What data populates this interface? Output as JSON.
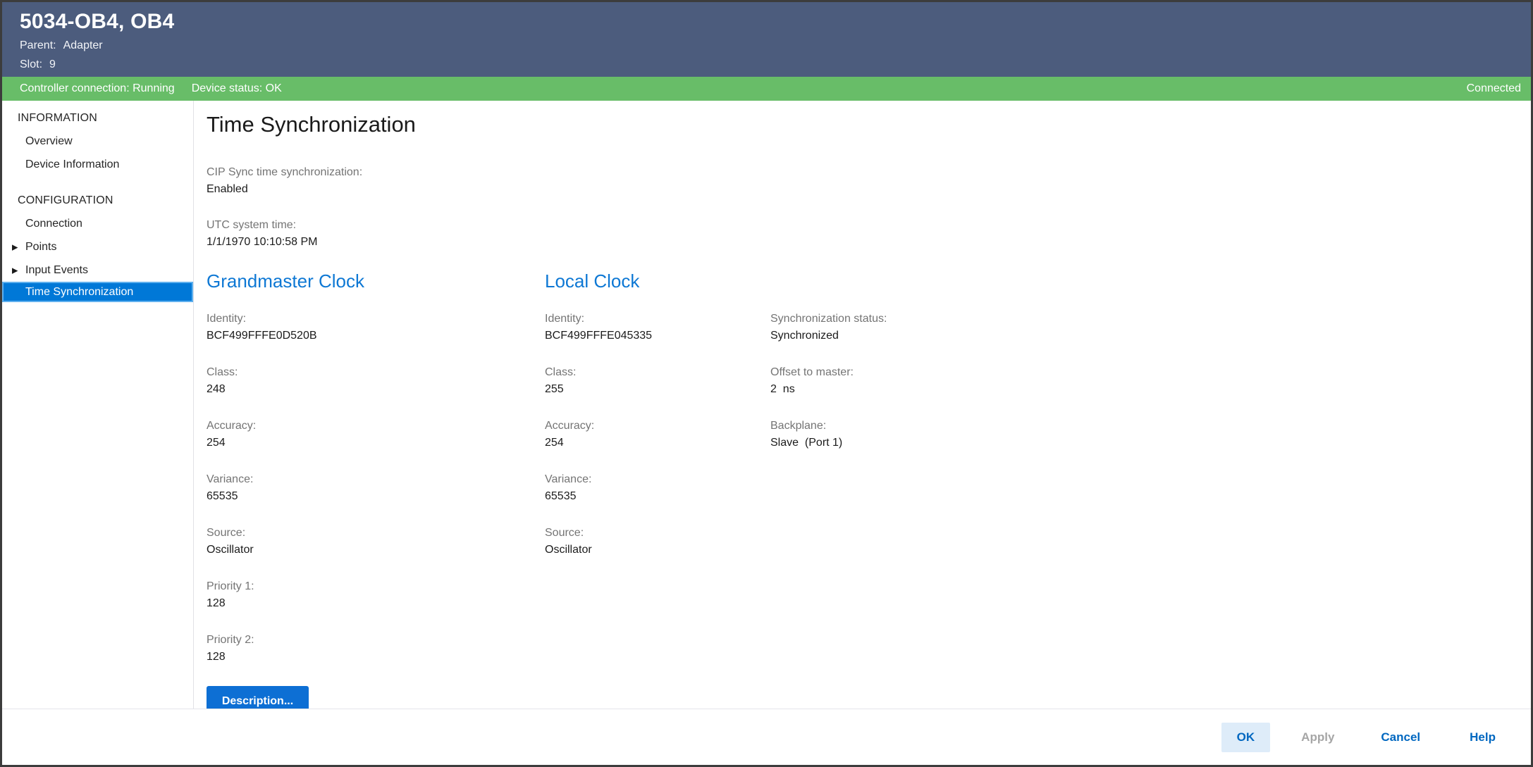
{
  "window": {
    "title": "5034-OB4, OB4",
    "parent_label": "Parent:",
    "parent_value": "Adapter",
    "slot_label": "Slot:",
    "slot_value": "9"
  },
  "status_bar": {
    "controller_connection": "Controller connection: Running",
    "device_status": "Device status: OK",
    "connection_state": "Connected"
  },
  "sidebar": {
    "expand_icon": "▶",
    "sections": [
      {
        "header": "INFORMATION",
        "items": [
          {
            "label": "Overview"
          },
          {
            "label": "Device Information"
          }
        ]
      },
      {
        "header": "CONFIGURATION",
        "items": [
          {
            "label": "Connection"
          },
          {
            "label": "Points",
            "expandable": true
          },
          {
            "label": "Input Events",
            "expandable": true
          },
          {
            "label": "Time Synchronization",
            "selected": true
          }
        ]
      }
    ]
  },
  "main": {
    "title": "Time Synchronization",
    "top_fields": [
      {
        "label": "CIP Sync time synchronization:",
        "value": "Enabled"
      },
      {
        "label": "UTC system time:",
        "value": "1/1/1970 10:10:58 PM"
      }
    ],
    "grandmaster": {
      "heading": "Grandmaster Clock",
      "fields": [
        {
          "label": "Identity:",
          "value": "BCF499FFFE0D520B"
        },
        {
          "label": "Class:",
          "value": "248"
        },
        {
          "label": "Accuracy:",
          "value": "254"
        },
        {
          "label": "Variance:",
          "value": "65535"
        },
        {
          "label": "Source:",
          "value": "Oscillator"
        },
        {
          "label": "Priority 1:",
          "value": "128"
        },
        {
          "label": "Priority 2:",
          "value": "128"
        }
      ],
      "description_button": "Description..."
    },
    "local": {
      "heading": "Local Clock",
      "fields": [
        {
          "label": "Identity:",
          "value": "BCF499FFFE045335"
        },
        {
          "label": "Class:",
          "value": "255"
        },
        {
          "label": "Accuracy:",
          "value": "254"
        },
        {
          "label": "Variance:",
          "value": "65535"
        },
        {
          "label": "Source:",
          "value": "Oscillator"
        }
      ]
    },
    "sync_status": {
      "fields": [
        {
          "label": "Synchronization status:",
          "value": "Synchronized"
        },
        {
          "label": "Offset to master:",
          "value": "2  ns"
        },
        {
          "label": "Backplane:",
          "value": "Slave  (Port 1)"
        }
      ]
    }
  },
  "footer": {
    "ok": "OK",
    "apply": "Apply",
    "cancel": "Cancel",
    "help": "Help"
  },
  "colors": {
    "header_bg": "#4c5c7d",
    "status_bar_bg": "#68bd68",
    "accent_blue": "#0078d7",
    "section_heading_blue": "#0e78d4",
    "description_button_bg": "#0d6fd4",
    "ok_button_bg": "#deecf9",
    "footer_link_blue": "#0067c0",
    "disabled_text": "#a6a6a6"
  }
}
